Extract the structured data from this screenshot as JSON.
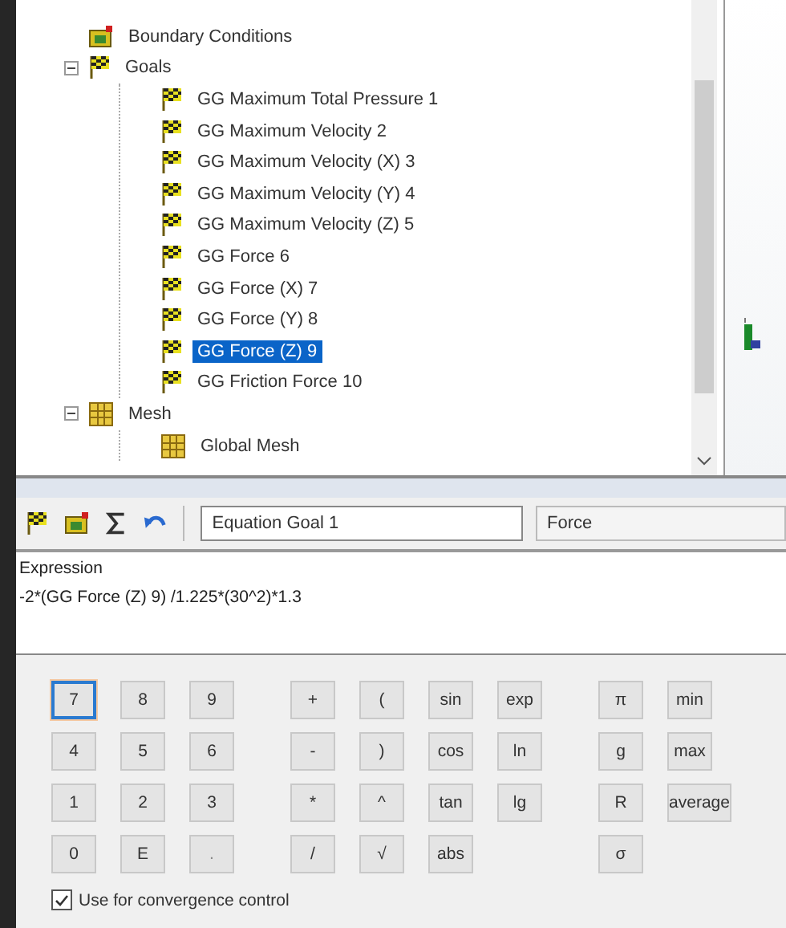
{
  "tree": {
    "items": [
      {
        "label": "Boundary Conditions",
        "kind": "boundary",
        "selected": false
      },
      {
        "label": "Goals",
        "kind": "flag",
        "selected": false,
        "expanded": true,
        "children": [
          {
            "label": "GG Maximum Total Pressure 1",
            "kind": "flag",
            "selected": false
          },
          {
            "label": "GG Maximum Velocity 2",
            "kind": "flag",
            "selected": false
          },
          {
            "label": "GG Maximum Velocity (X) 3",
            "kind": "flag",
            "selected": false
          },
          {
            "label": "GG Maximum Velocity (Y) 4",
            "kind": "flag",
            "selected": false
          },
          {
            "label": "GG Maximum Velocity (Z) 5",
            "kind": "flag",
            "selected": false
          },
          {
            "label": "GG Force 6",
            "kind": "flag",
            "selected": false
          },
          {
            "label": "GG Force (X) 7",
            "kind": "flag",
            "selected": false
          },
          {
            "label": "GG Force (Y) 8",
            "kind": "flag",
            "selected": false
          },
          {
            "label": "GG Force (Z) 9",
            "kind": "flag",
            "selected": true
          },
          {
            "label": "GG Friction Force 10",
            "kind": "flag",
            "selected": false
          }
        ]
      },
      {
        "label": "Mesh",
        "kind": "mesh",
        "selected": false,
        "expanded": true,
        "children": [
          {
            "label": "Global Mesh",
            "kind": "mesh",
            "selected": false
          }
        ]
      }
    ]
  },
  "toolbar": {
    "name_value": "Equation Goal 1",
    "unit_value": "Force"
  },
  "expression": {
    "label": "Expression",
    "value": "-2*(GG Force (Z) 9) /1.225*(30^2)*1.3"
  },
  "keypad": [
    {
      "keys": [
        {
          "label": "7",
          "focused": true,
          "disabled": false
        },
        {
          "label": "8",
          "focused": false,
          "disabled": false
        },
        {
          "label": "9",
          "focused": false,
          "disabled": false
        },
        {
          "label": "4",
          "focused": false,
          "disabled": false
        },
        {
          "label": "5",
          "focused": false,
          "disabled": false
        },
        {
          "label": "6",
          "focused": false,
          "disabled": false
        },
        {
          "label": "1",
          "focused": false,
          "disabled": false
        },
        {
          "label": "2",
          "focused": false,
          "disabled": false
        },
        {
          "label": "3",
          "focused": false,
          "disabled": false
        },
        {
          "label": "0",
          "focused": false,
          "disabled": false
        },
        {
          "label": "E",
          "focused": false,
          "disabled": false
        },
        {
          "label": ".",
          "focused": false,
          "disabled": true
        }
      ]
    },
    {
      "keys": [
        {
          "label": "+",
          "focused": false,
          "disabled": false
        },
        {
          "label": "(",
          "focused": false,
          "disabled": false
        },
        {
          "label": "sin",
          "focused": false,
          "disabled": false
        },
        {
          "label": "exp",
          "focused": false,
          "disabled": false
        },
        {
          "label": "-",
          "focused": false,
          "disabled": false
        },
        {
          "label": ")",
          "focused": false,
          "disabled": false
        },
        {
          "label": "cos",
          "focused": false,
          "disabled": false
        },
        {
          "label": "ln",
          "focused": false,
          "disabled": false
        },
        {
          "label": "*",
          "focused": false,
          "disabled": false
        },
        {
          "label": "^",
          "focused": false,
          "disabled": false
        },
        {
          "label": "tan",
          "focused": false,
          "disabled": false
        },
        {
          "label": "lg",
          "focused": false,
          "disabled": false
        },
        {
          "label": "/",
          "focused": false,
          "disabled": false
        },
        {
          "label": "√",
          "focused": false,
          "disabled": false
        },
        {
          "label": "abs",
          "focused": false,
          "disabled": false
        }
      ]
    },
    {
      "keys": [
        {
          "label": "π",
          "focused": false,
          "disabled": false
        },
        {
          "label": "min",
          "focused": false,
          "disabled": false
        },
        {
          "label": "g",
          "focused": false,
          "disabled": false
        },
        {
          "label": "max",
          "focused": false,
          "disabled": false
        },
        {
          "label": "R",
          "focused": false,
          "disabled": false
        },
        {
          "label": "average",
          "focused": false,
          "disabled": false
        },
        {
          "label": "σ",
          "focused": false,
          "disabled": false
        }
      ]
    }
  ],
  "convergence": {
    "label": "Use for convergence control",
    "checked": true
  }
}
